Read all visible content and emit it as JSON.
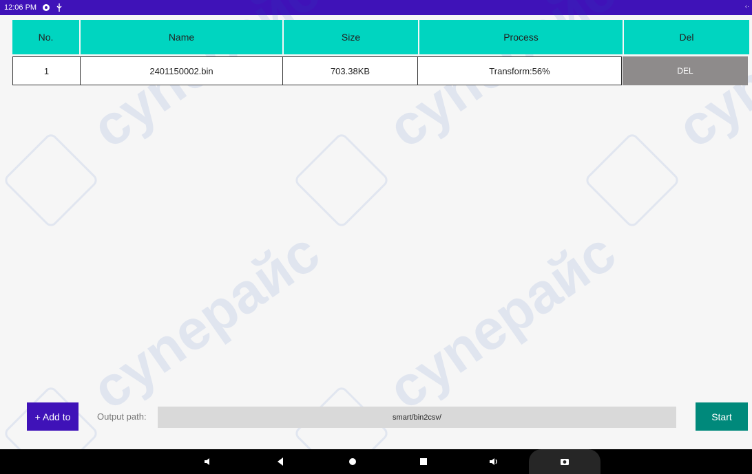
{
  "status_bar": {
    "time": "12:06 PM",
    "icons": [
      "settings-icon",
      "usb-icon"
    ]
  },
  "table": {
    "headers": [
      "No.",
      "Name",
      "Size",
      "Process",
      "Del"
    ],
    "rows": [
      {
        "no": "1",
        "name": "2401150002.bin",
        "size": "703.38KB",
        "process": "Transform:56%",
        "del_label": "DEL"
      }
    ]
  },
  "watermark": [
    "cynepaйс"
  ],
  "controls": {
    "add_label": "+ Add to",
    "output_label": "Output path:",
    "output_path": "smart/bin2csv/",
    "start_label": "Start"
  },
  "nav_bar": {
    "icons": [
      "volume-down-icon",
      "back-icon",
      "home-icon",
      "recents-icon",
      "volume-up-icon",
      "screenshot-icon"
    ]
  },
  "colors": {
    "status_bar": "#3f12b8",
    "header": "#00d5c0",
    "del_button": "#8e8b8b",
    "add_button": "#3f12b8",
    "start_button": "#00897b"
  }
}
